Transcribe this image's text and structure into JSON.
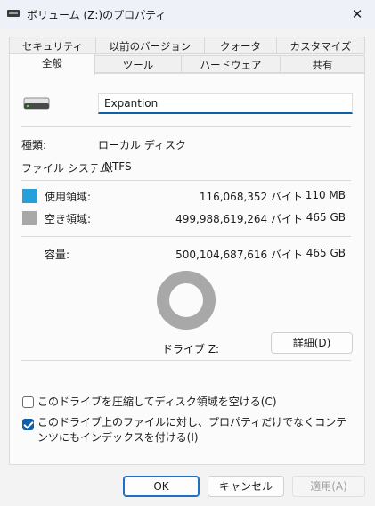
{
  "window": {
    "title": "ボリューム (Z:)のプロパティ",
    "close_glyph": "✕"
  },
  "tabs_row1": [
    "セキュリティ",
    "以前のバージョン",
    "クォータ",
    "カスタマイズ"
  ],
  "tabs_row2": [
    "全般",
    "ツール",
    "ハードウェア",
    "共有"
  ],
  "active_tab": "全般",
  "general": {
    "volume_name": "Expantion",
    "type_label": "種類:",
    "type_value": "ローカル ディスク",
    "fs_label": "ファイル システム:",
    "fs_value": "NTFS",
    "used_label": "使用領域:",
    "used_bytes": "116,068,352 バイト",
    "used_short": "110 MB",
    "free_label": "空き領域:",
    "free_bytes": "499,988,619,264 バイト",
    "free_short": "465 GB",
    "capacity_label": "容量:",
    "capacity_bytes": "500,104,687,616 バイト",
    "capacity_short": "465 GB",
    "drive_label": "ドライブ Z:",
    "details_button": "詳細(D)",
    "used_fraction": 0.00023,
    "colors": {
      "used": "#26a0da",
      "free": "#a8a8a8"
    },
    "compress_label": "このドライブを圧縮してディスク領域を空ける(C)",
    "compress_checked": false,
    "index_label": "このドライブ上のファイルに対し、プロパティだけでなくコンテンツにもインデックスを付ける(I)",
    "index_checked": true
  },
  "buttons": {
    "ok": "OK",
    "cancel": "キャンセル",
    "apply": "適用(A)"
  },
  "icons": {
    "title": "drive-icon",
    "close": "close-icon",
    "drive": "hard-drive-icon"
  }
}
